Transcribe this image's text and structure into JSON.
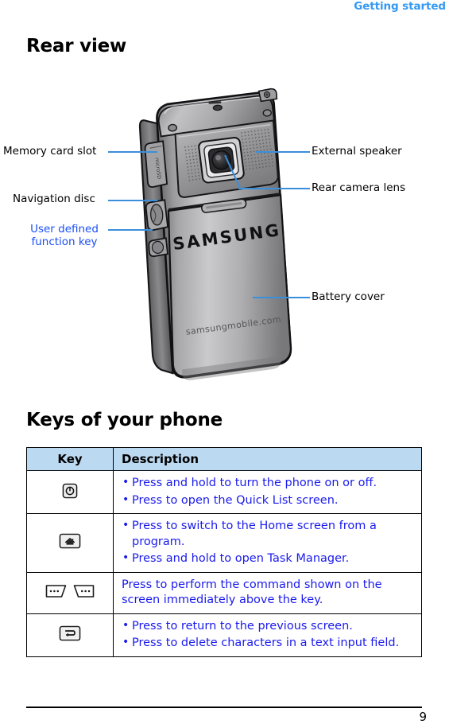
{
  "header": {
    "running_title": "Getting started"
  },
  "sections": {
    "rear_view_heading": "Rear view",
    "keys_heading": "Keys of your phone"
  },
  "figure": {
    "alt_name": "rear-view-of-phone",
    "brand_logo": "SAMSUNG",
    "brand_url": "samsungmobile.com",
    "callouts": [
      {
        "label": "Memory card slot",
        "side": "left",
        "color": "#000000"
      },
      {
        "label": "Navigation disc",
        "side": "left",
        "color": "#000000"
      },
      {
        "label": "User defined\nfunction key",
        "side": "left",
        "color": "#1a4ff5"
      },
      {
        "label": "External speaker",
        "side": "right",
        "color": "#000000"
      },
      {
        "label": "Rear camera lens",
        "side": "right",
        "color": "#000000"
      },
      {
        "label": "Battery cover",
        "side": "right",
        "color": "#000000"
      }
    ],
    "callout_left_1": "Memory card slot",
    "callout_left_2": "Navigation disc",
    "callout_left_3a": "User defined",
    "callout_left_3b": "function key",
    "callout_right_1": "External speaker",
    "callout_right_2": "Rear camera lens",
    "callout_right_3": "Battery cover"
  },
  "keys_table": {
    "columns": [
      "Key",
      "Description"
    ],
    "rows": [
      {
        "key_icon": "power-key-icon",
        "bullets": [
          "Press and hold to turn the phone on or off.",
          "Press to open the Quick List screen."
        ]
      },
      {
        "key_icon": "home-key-icon",
        "bullets": [
          "Press to switch to the Home screen from a program.",
          "Press and hold to open Task Manager."
        ]
      },
      {
        "key_icon": "soft-keys-icon",
        "plain": "Press to perform the command shown on the screen immediately above the key."
      },
      {
        "key_icon": "back-key-icon",
        "bullets": [
          "Press to return to the previous screen.",
          "Press to delete characters in a text input field."
        ]
      }
    ]
  },
  "footer": {
    "page_number": "9"
  },
  "colors": {
    "accent_blue": "#3399f3",
    "text_blue": "#1a1aee",
    "callout_blue": "#1a4ff5",
    "leader_line": "#3a8fdc",
    "table_header_bg": "#bcd9f2"
  }
}
